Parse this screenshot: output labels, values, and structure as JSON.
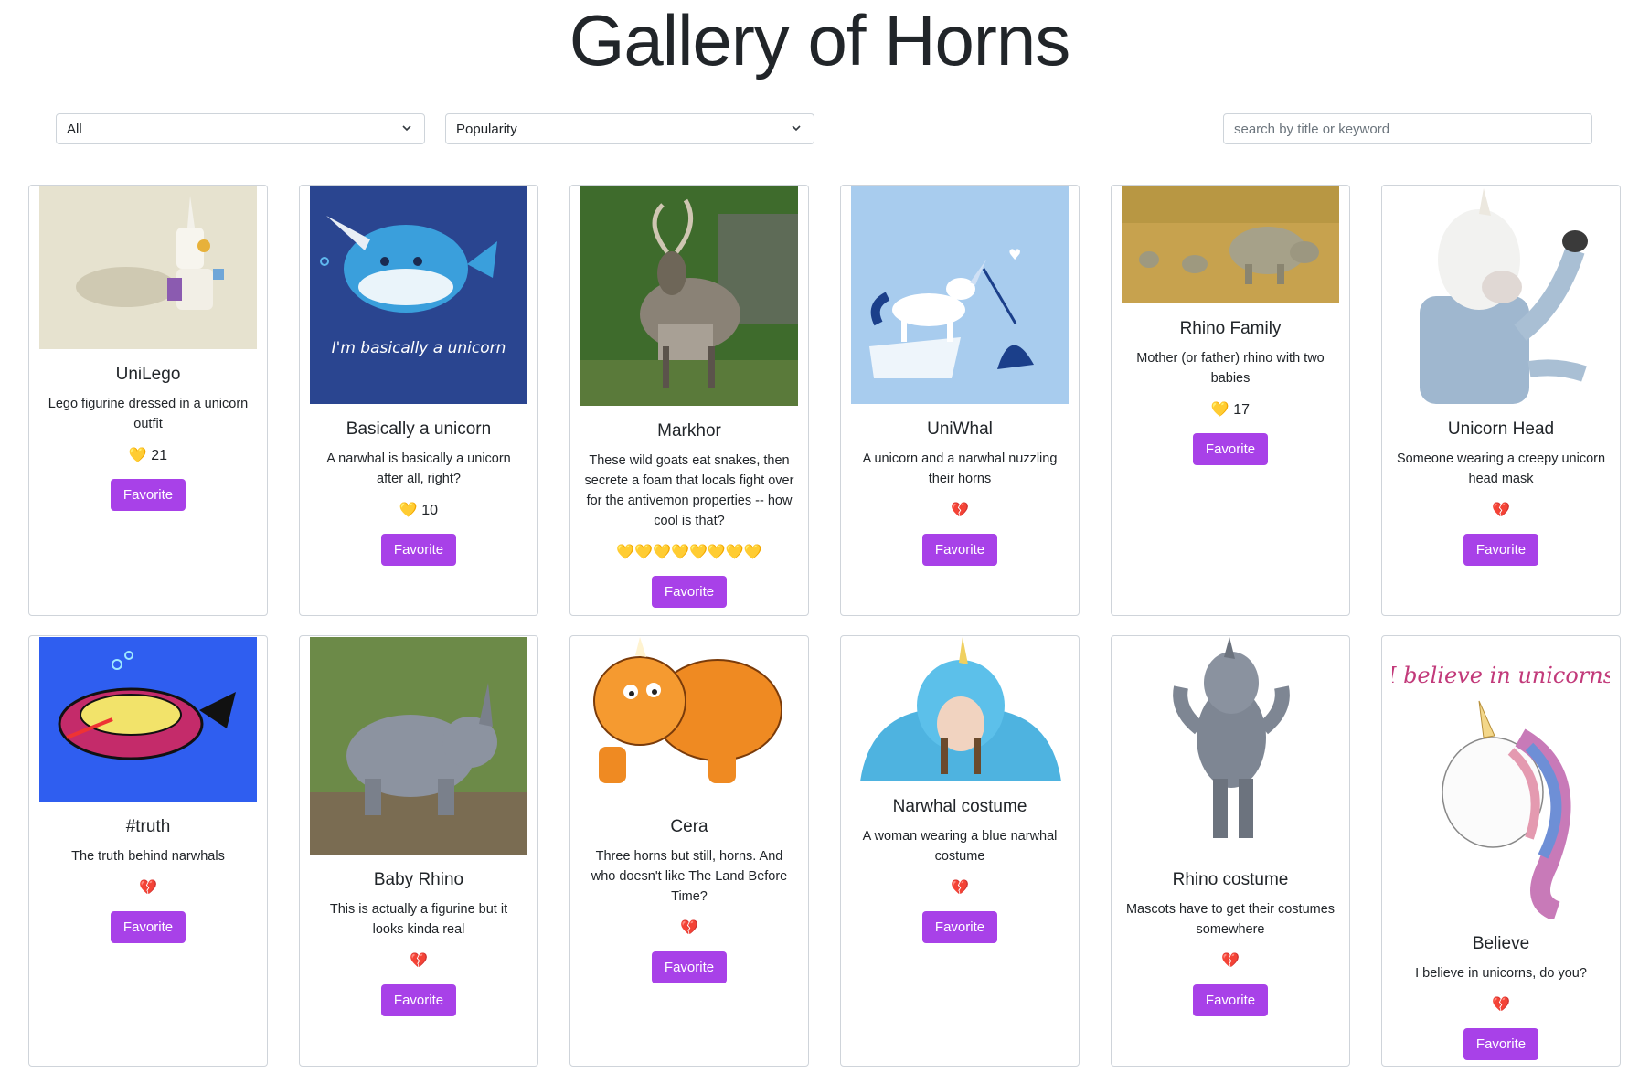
{
  "page": {
    "title": "Gallery of Horns"
  },
  "controls": {
    "filter_value": "All",
    "sort_value": "Popularity",
    "search_placeholder": "search by title or keyword"
  },
  "icons": {
    "heart_full": "💛",
    "heart_broken": "💔"
  },
  "cards": [
    {
      "title": "UniLego",
      "desc": "Lego figurine dressed in a unicorn outfit",
      "hearts": "💛 21",
      "button": "Favorite"
    },
    {
      "title": "Basically a unicorn",
      "desc": "A narwhal is basically a unicorn after all, right?",
      "hearts": "💛 10",
      "button": "Favorite",
      "image_caption": "I'm basically a unicorn"
    },
    {
      "title": "Markhor",
      "desc": "These wild goats eat snakes, then secrete a foam that locals fight over for the antivemon properties -- how cool is that?",
      "hearts": "💛💛💛💛💛💛💛💛",
      "button": "Favorite"
    },
    {
      "title": "UniWhal",
      "desc": "A unicorn and a narwhal nuzzling their horns",
      "hearts": "💔",
      "button": "Favorite"
    },
    {
      "title": "Rhino Family",
      "desc": "Mother (or father) rhino with two babies",
      "hearts": "💛 17",
      "button": "Favorite"
    },
    {
      "title": "Unicorn Head",
      "desc": "Someone wearing a creepy unicorn head mask",
      "hearts": "💔",
      "button": "Favorite"
    },
    {
      "title": "#truth",
      "desc": "The truth behind narwhals",
      "hearts": "💔",
      "button": "Favorite"
    },
    {
      "title": "Baby Rhino",
      "desc": "This is actually a figurine but it looks kinda real",
      "hearts": "💔",
      "button": "Favorite"
    },
    {
      "title": "Cera",
      "desc": "Three horns but still, horns. And who doesn't like The Land Before Time?",
      "hearts": "💔",
      "button": "Favorite"
    },
    {
      "title": "Narwhal costume",
      "desc": "A woman wearing a blue narwhal costume",
      "hearts": "💔",
      "button": "Favorite"
    },
    {
      "title": "Rhino costume",
      "desc": "Mascots have to get their costumes somewhere",
      "hearts": "💔",
      "button": "Favorite"
    },
    {
      "title": "Believe",
      "desc": "I believe in unicorns, do you?",
      "hearts": "💔",
      "button": "Favorite",
      "image_caption": "I believe in unicorns"
    }
  ]
}
